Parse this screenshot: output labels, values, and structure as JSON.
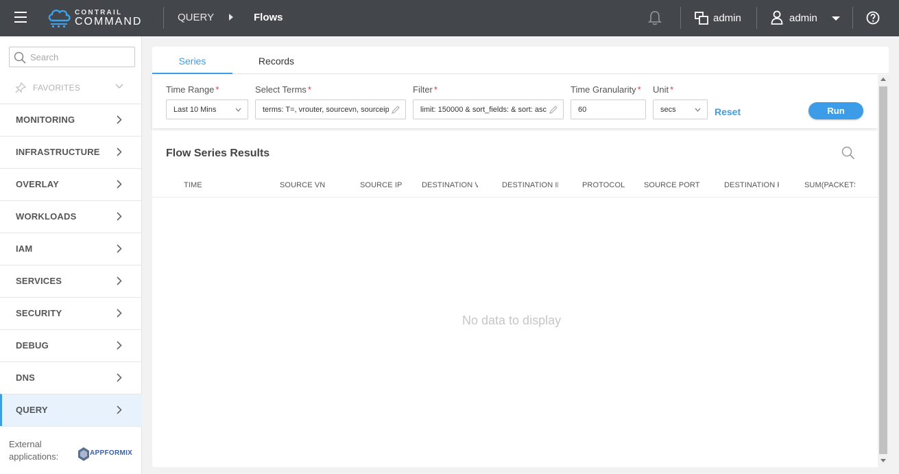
{
  "topbar": {
    "logo_small": "CONTRAIL",
    "logo_big": "COMMAND",
    "breadcrumb": [
      "QUERY",
      "Flows"
    ],
    "project_label": "admin",
    "user_label": "admin",
    "icons": [
      "hamburger-icon",
      "bell-icon",
      "project-icon",
      "user-icon",
      "help-icon"
    ]
  },
  "sidebar": {
    "search_placeholder": "Search",
    "favorites_label": "FAVORITES",
    "items": [
      {
        "label": "MONITORING"
      },
      {
        "label": "INFRASTRUCTURE"
      },
      {
        "label": "OVERLAY"
      },
      {
        "label": "WORKLOADS"
      },
      {
        "label": "IAM"
      },
      {
        "label": "SERVICES"
      },
      {
        "label": "SECURITY"
      },
      {
        "label": "DEBUG"
      },
      {
        "label": "DNS"
      },
      {
        "label": "QUERY",
        "active": true
      }
    ],
    "external_label": "External applications:",
    "appformix_label": "APPFORMIX"
  },
  "tabs": [
    {
      "label": "Series",
      "active": true
    },
    {
      "label": "Records",
      "active": false
    }
  ],
  "filters": {
    "time_range": {
      "label": "Time Range",
      "value": "Last 10 Mins"
    },
    "select_terms": {
      "label": "Select Terms",
      "value": "terms: T=, vrouter, sourcevn, sourceip, destvn, destip, protocol, sport, dport"
    },
    "filter": {
      "label": "Filter",
      "value": "limit: 150000 & sort_fields: & sort: asc"
    },
    "time_granularity": {
      "label": "Time Granularity",
      "value": "60"
    },
    "unit": {
      "label": "Unit",
      "value": "secs"
    },
    "required_mark": "*",
    "reset_label": "Reset",
    "run_label": "Run"
  },
  "results": {
    "title": "Flow Series Results",
    "columns": [
      "TIME",
      "SOURCE VN",
      "SOURCE IP",
      "DESTINATION VN",
      "DESTINATION IP",
      "PROTOCOL",
      "SOURCE PORT",
      "DESTINATION PORT",
      "SUM(PACKETS)"
    ],
    "empty_message": "No data to display"
  },
  "colors": {
    "topbar_bg": "#43474b",
    "accent": "#3c9ce8",
    "required": "#e53935",
    "active_nav_bg": "#e7f2fc"
  }
}
